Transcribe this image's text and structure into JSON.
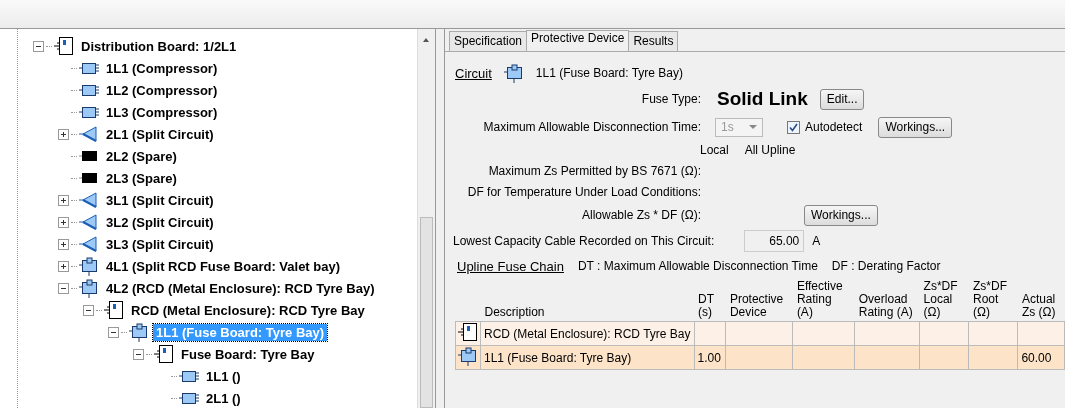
{
  "tree": [
    {
      "label": "Distribution Board: 1/2L1",
      "kind": "board",
      "expanded": true,
      "selected": false,
      "children": [
        {
          "label": "1L1 (Compressor)",
          "kind": "circuit",
          "selected": false
        },
        {
          "label": "1L2 (Compressor)",
          "kind": "circuit",
          "selected": false
        },
        {
          "label": "1L3 (Compressor)",
          "kind": "circuit",
          "selected": false
        },
        {
          "label": "2L1 (Split Circuit)",
          "kind": "split",
          "expanded": false,
          "selected": false
        },
        {
          "label": "2L2 (Spare)",
          "kind": "spare",
          "selected": false
        },
        {
          "label": "2L3 (Spare)",
          "kind": "spare",
          "selected": false
        },
        {
          "label": "3L1 (Split Circuit)",
          "kind": "split",
          "expanded": false,
          "selected": false
        },
        {
          "label": "3L2 (Split Circuit)",
          "kind": "split",
          "expanded": false,
          "selected": false
        },
        {
          "label": "3L3 (Split Circuit)",
          "kind": "split",
          "expanded": false,
          "selected": false
        },
        {
          "label": "4L1 (Split RCD Fuse Board: Valet bay)",
          "kind": "feed",
          "expanded": false,
          "selected": false
        },
        {
          "label": "4L2 (RCD (Metal Enclosure): RCD Tyre Bay)",
          "kind": "feed",
          "expanded": true,
          "selected": false,
          "children": [
            {
              "label": "RCD (Metal Enclosure): RCD Tyre Bay",
              "kind": "board",
              "expanded": true,
              "selected": false,
              "children": [
                {
                  "label": "1L1 (Fuse Board: Tyre Bay)",
                  "kind": "feed",
                  "expanded": true,
                  "selected": true,
                  "children": [
                    {
                      "label": "Fuse Board: Tyre Bay",
                      "kind": "board",
                      "expanded": true,
                      "selected": false,
                      "children": [
                        {
                          "label": "1L1 ()",
                          "kind": "circuit",
                          "selected": false
                        },
                        {
                          "label": "2L1 ()",
                          "kind": "circuit",
                          "selected": false
                        }
                      ]
                    }
                  ]
                }
              ]
            }
          ]
        }
      ]
    }
  ],
  "tabs": [
    {
      "label": "Specification",
      "selected": false
    },
    {
      "label": "Protective Device",
      "selected": true
    },
    {
      "label": "Results",
      "selected": false
    }
  ],
  "circuit": {
    "link": "Circuit",
    "name": "1L1 (Fuse Board: Tyre Bay)"
  },
  "fuse_type": {
    "label": "Fuse Type:",
    "value": "Solid Link",
    "button": "Edit..."
  },
  "disconnection": {
    "label": "Maximum Allowable Disconnection Time:",
    "value": "1s",
    "disabled": true,
    "checkbox": "Autodetect",
    "checked": true,
    "button": "Workings..."
  },
  "column_headings": [
    "Local",
    "All Upline"
  ],
  "max_zs_label": "Maximum Zs Permitted by BS 7671 (Ω):",
  "df_label": "DF for Temperature Under Load Conditions:",
  "allowable": {
    "label": "Allowable Zs * DF (Ω):",
    "button": "Workings..."
  },
  "lowest_cable": {
    "label": "Lowest Capacity Cable Recorded on This Circuit:",
    "value": "65.00",
    "unit": "A"
  },
  "chain": {
    "link": "Upline Fuse Chain",
    "notes": [
      "DT : Maximum Allowable Disconnection Time",
      "DF : Derating Factor"
    ]
  },
  "table": {
    "columns": [
      "Description",
      "DT (s)",
      "Protective Device",
      "Effective Rating (A)",
      "Overload Rating (A)",
      "Zs*DF Local (Ω)",
      "Zs*DF Root (Ω)",
      "Actual Zs (Ω)"
    ],
    "rows": [
      {
        "kind": "board",
        "selected": false,
        "cells": [
          "RCD (Metal Enclosure): RCD Tyre Bay",
          "",
          "",
          "",
          "",
          "",
          "",
          ""
        ]
      },
      {
        "kind": "feed",
        "selected": true,
        "cells": [
          "1L1 (Fuse Board: Tyre Bay)",
          "1.00",
          "",
          "",
          "",
          "",
          "",
          "60.00"
        ]
      }
    ]
  }
}
